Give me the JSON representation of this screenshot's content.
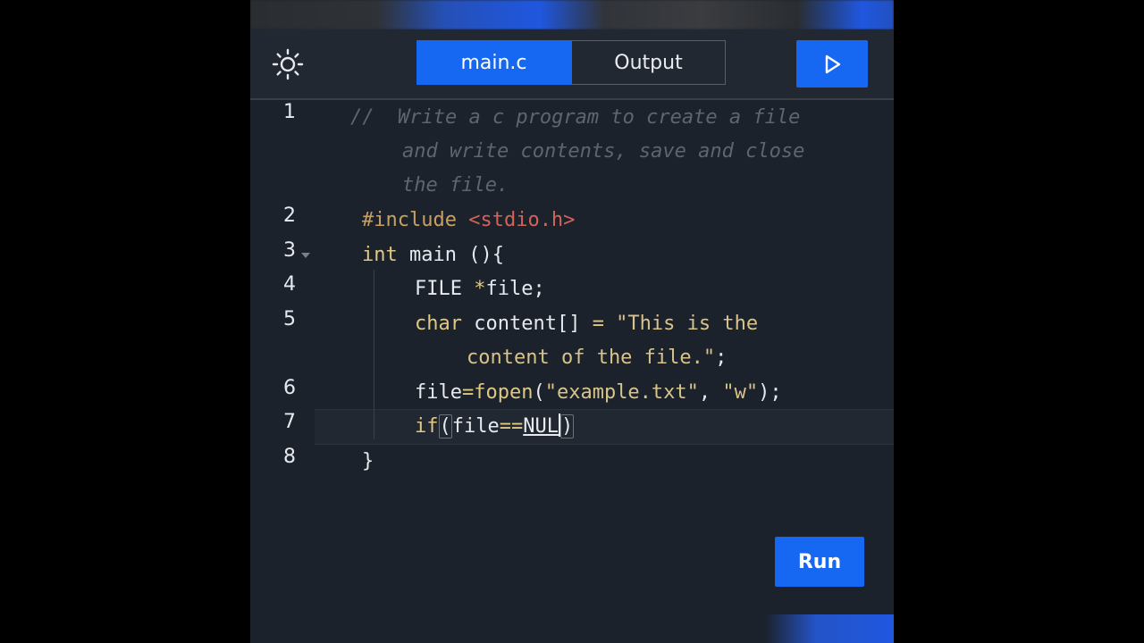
{
  "tabs": [
    {
      "label": "main.c",
      "active": true
    },
    {
      "label": "Output",
      "active": false
    }
  ],
  "icons": {
    "theme": "sun-icon",
    "run_top": "play-icon"
  },
  "colors": {
    "accent": "#1668f2",
    "background": "#1c222b"
  },
  "editor": {
    "line_numbers": [
      "1",
      "2",
      "3",
      "4",
      "5",
      "6",
      "7",
      "8"
    ],
    "lines": {
      "l1a": "//  Write a c program to create a file",
      "l1b": "and write contents, save and close",
      "l1c": "the file.",
      "l2_dir": "#include",
      "l2_hdr": "<stdio.h>",
      "l3_kw": "int",
      "l3_rest": " main (){",
      "l4_type": "FILE ",
      "l4_op": "*",
      "l4_rest": "file;",
      "l5_kw": "char",
      "l5_rest": " content[] ",
      "l5_op": "=",
      "l5_str": " \"This is the",
      "l5b_str": "content of the file.\"",
      "l5b_end": ";",
      "l6_id": "file",
      "l6_op": "=",
      "l6_fn": "fopen",
      "l6_p1": "(",
      "l6_s1": "\"example.txt\"",
      "l6_comma": ", ",
      "l6_s2": "\"w\"",
      "l6_end": ");",
      "l7_kw": "if",
      "l7_p1": "(",
      "l7_id": "file",
      "l7_op": "==",
      "l7_null": "NUL",
      "l7_p2": ")",
      "l8": "}"
    }
  },
  "run_button": {
    "label": "Run"
  }
}
